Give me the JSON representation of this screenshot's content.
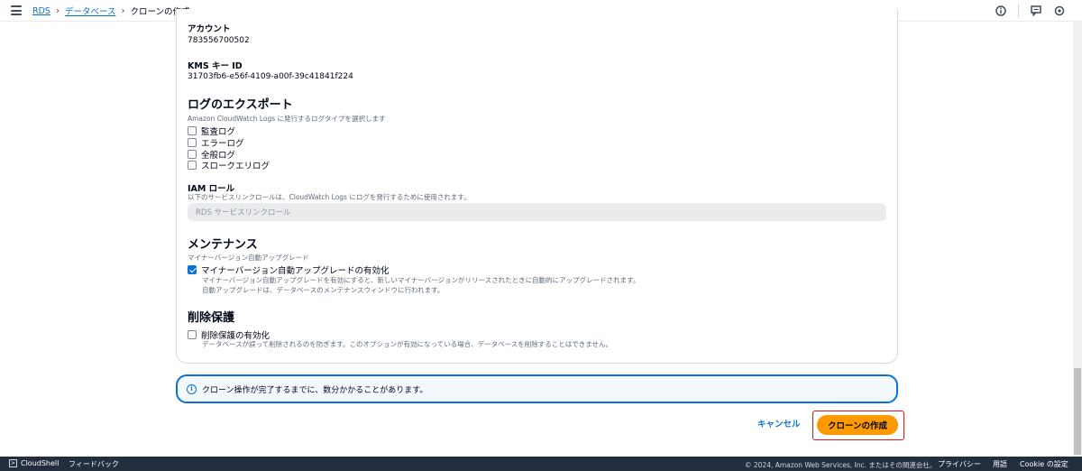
{
  "breadcrumb": {
    "items": [
      "RDS",
      "データベース"
    ],
    "current": "クローンの作成"
  },
  "account": {
    "label": "アカウント",
    "value": "783556700502"
  },
  "kms": {
    "label": "KMS キー ID",
    "value": "31703fb6-e56f-4109-a00f-39c41841f224"
  },
  "log_export": {
    "title": "ログのエクスポート",
    "description": "Amazon CloudWatch Logs に発行するログタイプを選択します",
    "options": [
      {
        "label": "監査ログ",
        "checked": false
      },
      {
        "label": "エラーログ",
        "checked": false
      },
      {
        "label": "全般ログ",
        "checked": false
      },
      {
        "label": "スロークエリログ",
        "checked": false
      }
    ]
  },
  "iam_role": {
    "label": "IAM ロール",
    "description": "以下のサービスリンクロールは、CloudWatch Logs にログを発行するために使用されます。",
    "value": "RDS サービスリンクロール"
  },
  "maintenance": {
    "title": "メンテナンス",
    "description": "マイナーバージョン自動アップグレード",
    "checkbox_label": "マイナーバージョン自動アップグレードの有効化",
    "checked": true,
    "sub_lines": [
      "マイナーバージョン自動アップグレードを有効にすると、新しいマイナーバージョンがリリースされたときに自動的にアップグレードされます。",
      "自動アップグレードは、データベースのメンテナンスウィンドウに行われます。"
    ]
  },
  "deletion": {
    "title": "削除保護",
    "checkbox_label": "削除保護の有効化",
    "checked": false,
    "sub_line": "データベースが誤って削除されるのを防ぎます。このオプションが有効になっている場合、データベースを削除することはできません。"
  },
  "alert": {
    "text": "クローン操作が完了するまでに、数分かかることがあります。"
  },
  "actions": {
    "cancel": "キャンセル",
    "create": "クローンの作成"
  },
  "footer": {
    "cloudshell": "CloudShell",
    "feedback": "フィードバック",
    "copyright": "© 2024, Amazon Web Services, Inc. またはその関連会社。",
    "privacy": "プライバシー",
    "terms": "用語",
    "cookie": "Cookie の設定"
  },
  "colors": {
    "accent": "#0972d3",
    "primary_button": "#ff9900",
    "highlight": "#d91515",
    "footer_bg": "#232f3e"
  }
}
